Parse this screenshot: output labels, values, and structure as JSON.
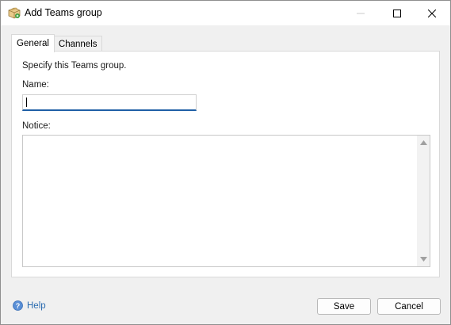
{
  "window": {
    "title": "Add Teams group"
  },
  "tabs": [
    {
      "label": "General",
      "active": true
    },
    {
      "label": "Channels",
      "active": false
    }
  ],
  "general": {
    "instructions": "Specify this Teams group.",
    "name_label": "Name:",
    "name_value": "",
    "notice_label": "Notice:",
    "notice_value": ""
  },
  "footer": {
    "help_label": "Help",
    "save_label": "Save",
    "cancel_label": "Cancel"
  },
  "icons": {
    "title": "teams-group-box-icon",
    "minimize": "minimize-icon",
    "maximize": "maximize-icon",
    "close": "close-icon",
    "help": "help-circle-icon",
    "scroll_up": "scroll-up-arrow-icon",
    "scroll_down": "scroll-down-arrow-icon"
  },
  "colors": {
    "accent": "#1f5fa6",
    "help_link": "#2b6cb0",
    "window_bg": "#f0f0f0",
    "panel_bg": "#ffffff"
  }
}
